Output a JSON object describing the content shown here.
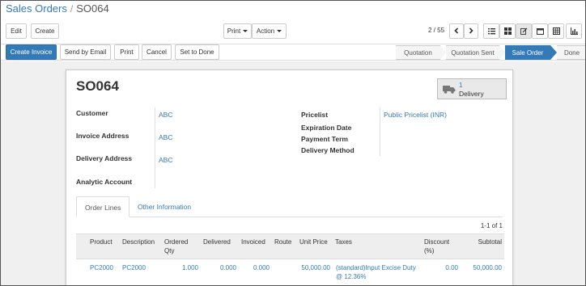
{
  "breadcrumb": {
    "parent": "Sales Orders",
    "separator": "/",
    "current": "SO064"
  },
  "toolbar": {
    "edit_label": "Edit",
    "create_label": "Create",
    "print_label": "Print",
    "action_label": "Action",
    "pager": "2 / 55"
  },
  "actions": {
    "create_invoice": "Create Invoice",
    "send_email": "Send by Email",
    "print": "Print",
    "cancel": "Cancel",
    "set_to_done": "Set to Done"
  },
  "status": {
    "stages": [
      "Quotation",
      "Quotation Sent",
      "Sale Order",
      "Done"
    ],
    "active": "Sale Order"
  },
  "order": {
    "name": "SO064",
    "delivery_count": "1",
    "delivery_label": "Delivery",
    "left_fields": [
      {
        "label": "Customer",
        "value": "ABC"
      },
      {
        "label": "Invoice Address",
        "value": "ABC"
      },
      {
        "label": "Delivery Address",
        "value": "ABC"
      },
      {
        "label": "Analytic Account",
        "value": ""
      }
    ],
    "right_fields": [
      {
        "label": "Pricelist",
        "value": "Public Pricelist (INR)"
      },
      {
        "label": "Expiration Date",
        "value": ""
      },
      {
        "label": "Payment Term",
        "value": ""
      },
      {
        "label": "Delivery Method",
        "value": ""
      }
    ]
  },
  "tabs": [
    "Order Lines",
    "Other Information"
  ],
  "lines": {
    "count": "1-1 of 1",
    "headers": [
      "Product",
      "Description",
      "Ordered Qty",
      "Delivered",
      "Invoiced",
      "Route",
      "Unit Price",
      "Taxes",
      "Discount (%)",
      "Subtotal"
    ],
    "rows": [
      [
        "PC2000",
        "PC2000",
        "1.000",
        "0.000",
        "0.000",
        "",
        "50,000.00",
        "(standard)Input Excise Duty @ 12.36%",
        "0.00",
        "50,000.00"
      ]
    ]
  },
  "colors": {
    "accent": "#337ab7",
    "background": "#f0f0f0"
  }
}
